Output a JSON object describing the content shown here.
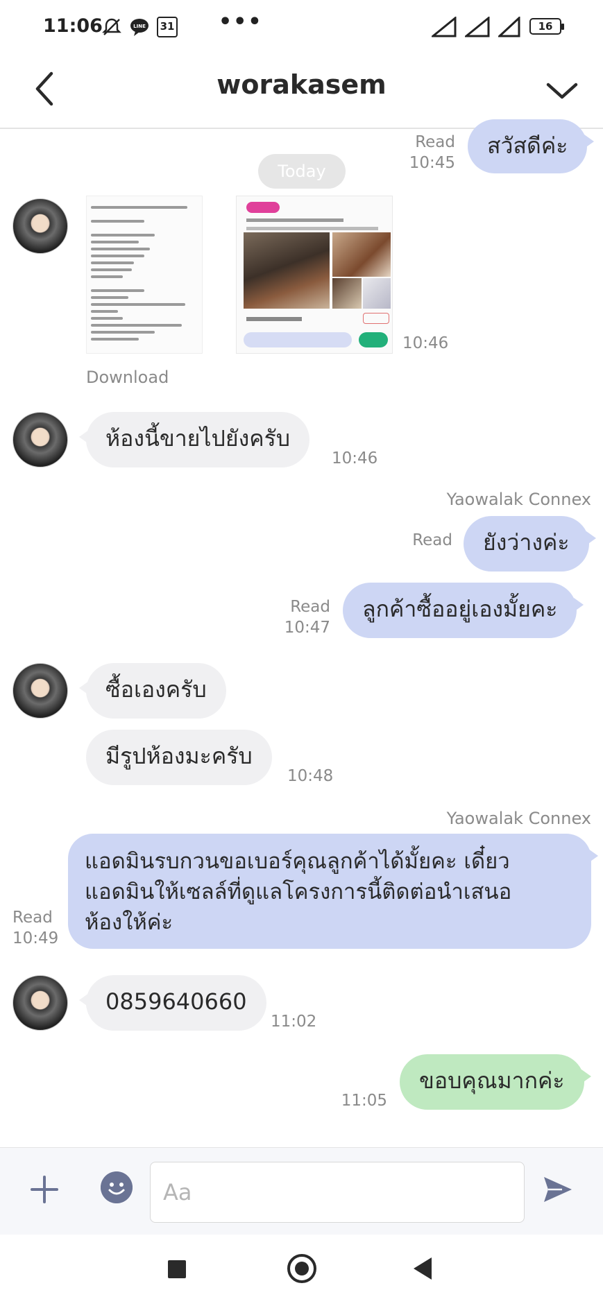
{
  "status_bar": {
    "time": "11:06",
    "calendar_day": "31",
    "more": "•••",
    "battery": "16"
  },
  "header": {
    "title": "worakasem"
  },
  "chat": {
    "msg_hello": {
      "text": "สวัสดีค่ะ",
      "status": "Read",
      "time": "10:45"
    },
    "date_separator": "Today",
    "images": {
      "time": "10:46",
      "download_label": "Download"
    },
    "msg_sold": {
      "text": "ห้องนี้ขายไปยังครับ",
      "time": "10:46"
    },
    "sender_1": "Yaowalak Connex",
    "msg_available": {
      "text": "ยังว่างค่ะ",
      "status": "Read"
    },
    "msg_buy_self": {
      "text": "ลูกค้าซื้ออยู่เองมั้ยคะ",
      "status": "Read",
      "time": "10:47"
    },
    "msg_buy_own": {
      "text": "ซื้อเองครับ"
    },
    "msg_photos": {
      "text": "มีรูปห้องมะครับ",
      "time": "10:48"
    },
    "sender_2": "Yaowalak Connex",
    "msg_phone_request": {
      "lines": [
        "แอดมินรบกวนขอเบอร์คุณลูกค้าได้มั้ยคะ เดี๋ยว",
        "แอดมินให้เซลล์ที่ดูแลโครงการนี้ติดต่อนำเสนอ",
        "ห้องให้ค่ะ"
      ],
      "status": "Read",
      "time": "10:49"
    },
    "msg_phone": {
      "text": "0859640660",
      "time": "11:02"
    },
    "msg_thanks": {
      "text": "ขอบคุณมากค่ะ",
      "time": "11:05"
    }
  },
  "input": {
    "placeholder": "Aa"
  },
  "colors": {
    "outgoing_bubble": "#cdd6f4",
    "incoming_bubble": "#f0f0f2",
    "sent_pending_bubble": "#bfe9c0",
    "accent": "#6a7394"
  }
}
